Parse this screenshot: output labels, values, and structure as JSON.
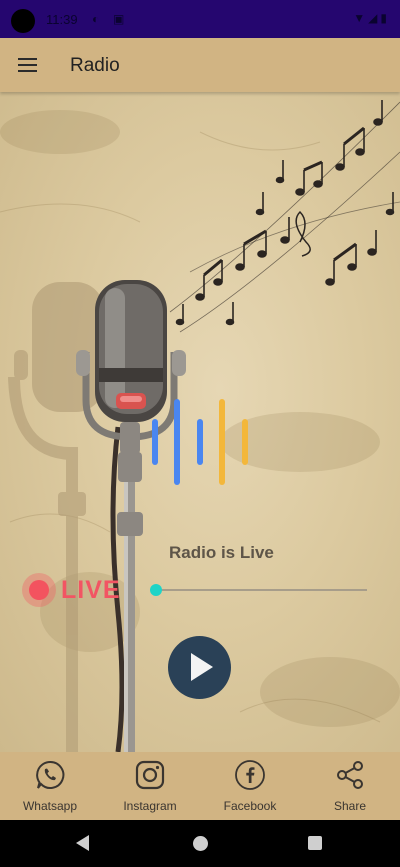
{
  "status_bar": {
    "time": "11:39"
  },
  "app_bar": {
    "title": "Radio"
  },
  "player": {
    "status_text": "Radio is Live",
    "live_label": "LIVE"
  },
  "bottom_nav": {
    "items": [
      {
        "label": "Whatsapp",
        "icon": "whatsapp-icon"
      },
      {
        "label": "Instagram",
        "icon": "instagram-icon"
      },
      {
        "label": "Facebook",
        "icon": "facebook-icon"
      },
      {
        "label": "Share",
        "icon": "share-icon"
      }
    ]
  },
  "colors": {
    "status_bar": "#25066f",
    "app_bar": "#d1b483",
    "live_red": "#f25563",
    "seek_thumb": "#1fd4c7",
    "play_button": "#2a4157",
    "equalizer_blue": "#4a86f0",
    "equalizer_yellow": "#f3b73a"
  }
}
